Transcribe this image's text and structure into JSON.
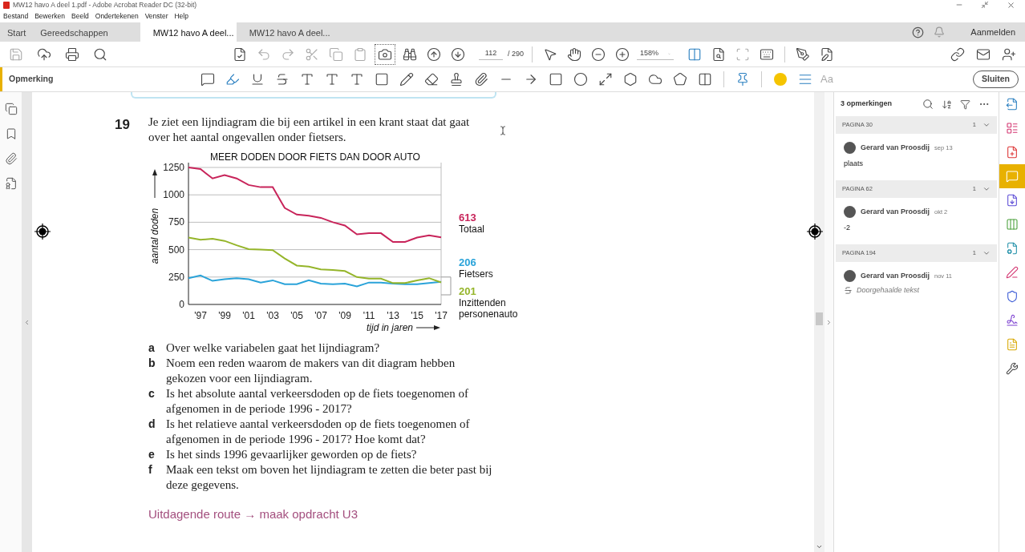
{
  "window": {
    "title": "MW12 havo A deel 1.pdf - Adobe Acrobat Reader DC (32-bit)"
  },
  "menu": [
    "Bestand",
    "Bewerken",
    "Beeld",
    "Ondertekenen",
    "Venster",
    "Help"
  ],
  "tabs": [
    {
      "label": "Start",
      "selected": false
    },
    {
      "label": "Gereedschappen",
      "selected": false
    },
    {
      "label": "MW12 havo A deel...",
      "selected": true
    },
    {
      "label": "MW12 havo A deel...",
      "selected": false
    }
  ],
  "sign_in": "Aanmelden",
  "toolbar": {
    "page": "112",
    "page_total": "/ 290",
    "zoom": "158%"
  },
  "comment_toolbar": {
    "title": "Opmerking",
    "font_label": "Aa",
    "color": "#f5c400",
    "close": "Sluiten"
  },
  "document": {
    "number": "19",
    "intro": "Je ziet een lijndiagram die bij een artikel in een krant staat dat gaat over het aantal ongevallen onder fietsers.",
    "chart_data": {
      "type": "line",
      "title": "MEER DODEN DOOR FIETS DAN DOOR AUTO",
      "ylabel": "aantal doden",
      "xlabel": "tijd in jaren",
      "x": [
        1996,
        1997,
        1998,
        1999,
        2000,
        2001,
        2002,
        2003,
        2004,
        2005,
        2006,
        2007,
        2008,
        2009,
        2010,
        2011,
        2012,
        2013,
        2014,
        2015,
        2016,
        2017
      ],
      "series": [
        {
          "name": "Totaal",
          "color": "#c8245a",
          "values": [
            1250,
            1235,
            1150,
            1180,
            1150,
            1090,
            1070,
            1070,
            880,
            820,
            810,
            790,
            750,
            720,
            640,
            650,
            650,
            570,
            570,
            610,
            630,
            613
          ]
        },
        {
          "name": "Fietsers",
          "color": "#2aa3d9",
          "values": [
            240,
            265,
            215,
            230,
            240,
            230,
            200,
            220,
            185,
            185,
            220,
            190,
            185,
            190,
            165,
            200,
            200,
            190,
            185,
            185,
            195,
            206
          ]
        },
        {
          "name": "Inzittenden personenauto",
          "color": "#95b52a",
          "values": [
            610,
            590,
            600,
            580,
            540,
            505,
            500,
            495,
            420,
            355,
            345,
            320,
            315,
            305,
            250,
            235,
            235,
            195,
            195,
            220,
            240,
            201
          ]
        }
      ],
      "ylim": [
        0,
        1250
      ],
      "yticks": [
        0,
        250,
        500,
        750,
        1000,
        1250
      ],
      "xticks": [
        {
          "value": 1997,
          "label": "'97"
        },
        {
          "value": 1999,
          "label": "'99"
        },
        {
          "value": 2001,
          "label": "'01"
        },
        {
          "value": 2003,
          "label": "'03"
        },
        {
          "value": 2005,
          "label": "'05"
        },
        {
          "value": 2007,
          "label": "'07"
        },
        {
          "value": 2009,
          "label": "'09"
        },
        {
          "value": 2011,
          "label": "'11"
        },
        {
          "value": 2013,
          "label": "'13"
        },
        {
          "value": 2015,
          "label": "'15"
        },
        {
          "value": 2017,
          "label": "'17"
        }
      ],
      "xlim": [
        1996,
        2017
      ],
      "grid": true,
      "annotations": [
        "613",
        "206",
        "201"
      ]
    },
    "questions": [
      {
        "letter": "a",
        "text": "Over welke variabelen gaat het lijndiagram?"
      },
      {
        "letter": "b",
        "text": "Noem een reden waarom de makers van dit diagram hebben gekozen voor een lijndiagram."
      },
      {
        "letter": "c",
        "text": "Is het absolute aantal verkeersdoden op de fiets toegenomen of afgenomen in de periode 1996 - 2017?"
      },
      {
        "letter": "d",
        "text": "Is het relatieve aantal verkeersdoden op de fiets toegenomen of afgenomen in de periode 1996 - 2017? Hoe komt dat?"
      },
      {
        "letter": "e",
        "text": "Is het sinds 1996 gevaarlijker geworden op de fiets?"
      },
      {
        "letter": "f",
        "text": "Maak een tekst om boven het lijndiagram te zetten die beter past bij deze gegevens."
      }
    ],
    "link": "Uitdagende route → maak opdracht U3"
  },
  "comments": {
    "title": "3 opmerkingen",
    "groups": [
      {
        "page": "PAGINA 30",
        "count": "1",
        "author": "Gerard van Proosdij",
        "date": "sep 13",
        "kind": "note",
        "body": "plaats"
      },
      {
        "page": "PAGINA 62",
        "count": "1",
        "author": "Gerard van Proosdij",
        "date": "okt 2",
        "kind": "note",
        "body": "-2"
      },
      {
        "page": "PAGINA 194",
        "count": "1",
        "author": "Gerard van Proosdij",
        "date": "nov 11",
        "kind": "strikeout",
        "body": "Doorgehaalde tekst"
      }
    ]
  },
  "right_rail": [
    {
      "selected": false
    },
    {
      "selected": false
    },
    {
      "selected": false
    },
    {
      "selected": true
    },
    {
      "selected": false
    },
    {
      "selected": false
    },
    {
      "selected": false
    },
    {
      "selected": false
    },
    {
      "selected": false
    },
    {
      "selected": false
    },
    {
      "selected": false
    },
    {
      "selected": false
    }
  ]
}
